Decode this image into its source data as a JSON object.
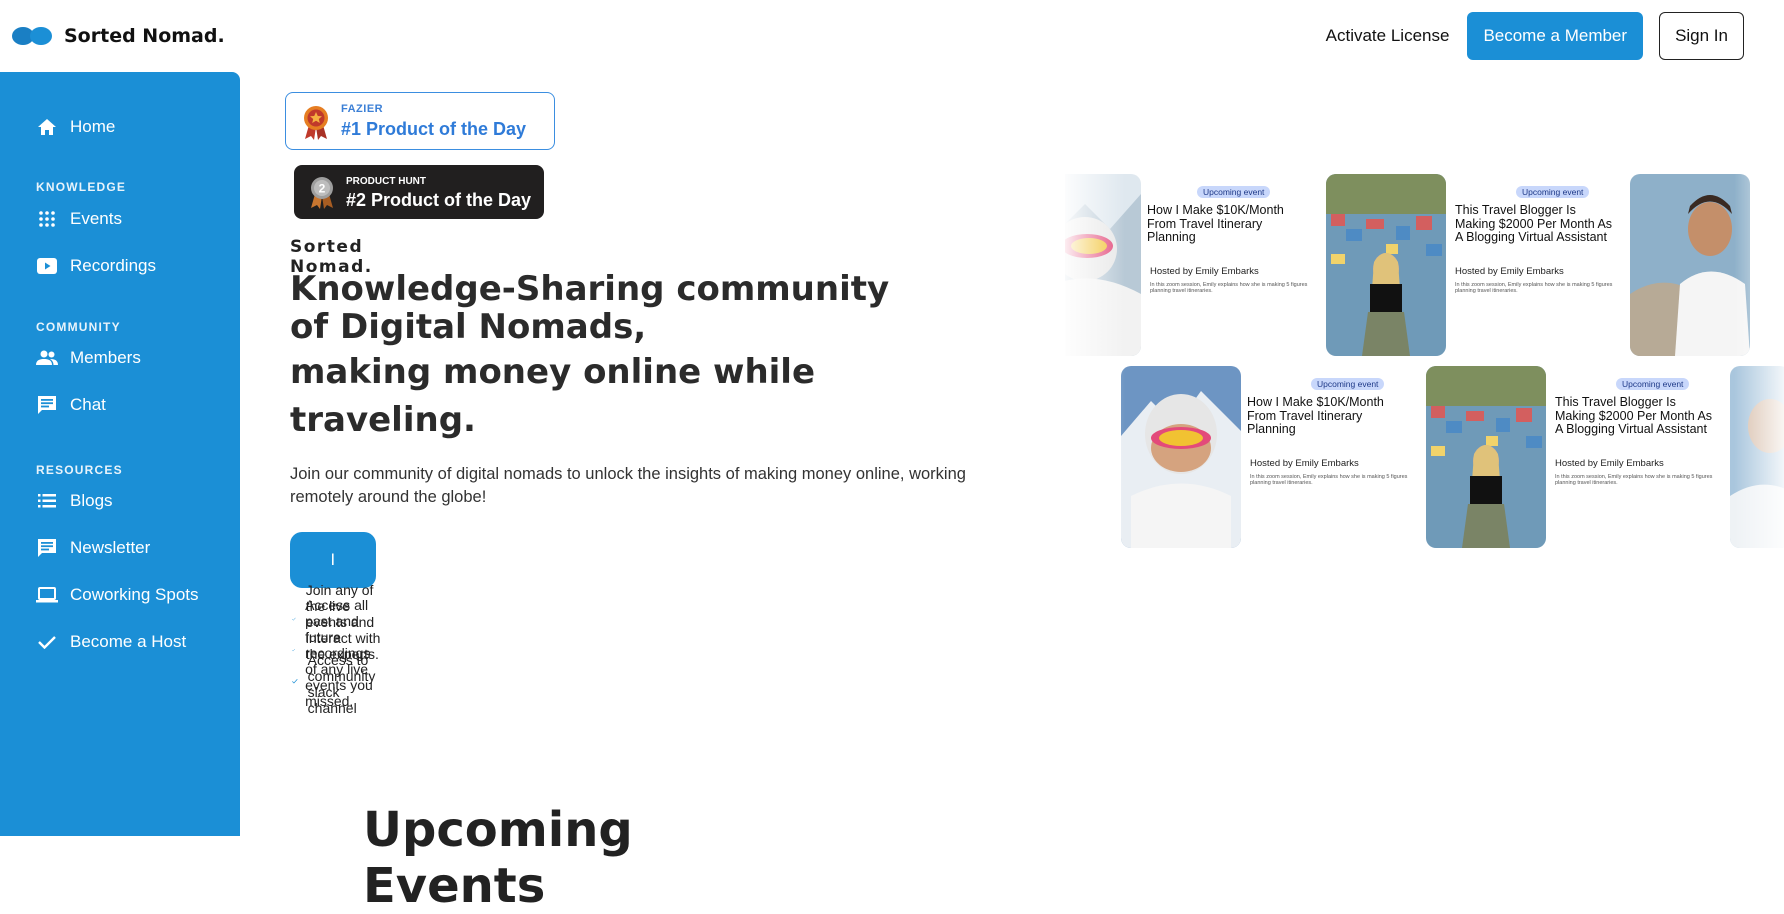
{
  "header": {
    "brand": "Sorted Nomad.",
    "activate_license": "Activate License",
    "become_member": "Become a Member",
    "sign_in": "Sign In"
  },
  "sidebar": {
    "home": "Home",
    "sections": [
      {
        "heading": "KNOWLEDGE",
        "items": [
          "Events",
          "Recordings"
        ]
      },
      {
        "heading": "COMMUNITY",
        "items": [
          "Members",
          "Chat"
        ]
      },
      {
        "heading": "RESOURCES",
        "items": [
          "Blogs",
          "Newsletter",
          "Coworking Spots",
          "Become a Host"
        ]
      }
    ]
  },
  "badges": {
    "fazier_small": "FAZIER",
    "fazier_big": "#1 Product of the Day",
    "ph_small": "PRODUCT HUNT",
    "ph_big": "#2 Product of the Day",
    "ph_rank": "2"
  },
  "hero": {
    "brand_small": "Sorted Nomad.",
    "line1": "Knowledge-Sharing community of Digital Nomads,",
    "line2": "making money online while",
    "line3": "traveling.",
    "subtitle": "Join our community of digital nomads to unlock the insights of making money online, working remotely around the globe!",
    "cta": "I WANT TO JOIN FOR FREE",
    "bullets": [
      "Join any of the live events and interact with the experts.",
      "Access all past and future recordings of any live events you missed.",
      "Access to community slack channel"
    ]
  },
  "cards": {
    "tag": "Upcoming event",
    "card1_title": "How I Make $10K/Month From Travel Itinerary Planning",
    "card2_title": "This Travel Blogger Is Making  $2000 Per Month As A Blogging Virtual Assistant",
    "host_prefix": "Hosted by ",
    "host_name": "Emily Embarks",
    "desc": "In this zoom session, Emily explains how she is making 5 figures planning travel itineraries."
  },
  "sections": {
    "upcoming_title": "Upcoming Events"
  },
  "colors": {
    "primary": "#1b8fd6",
    "fazier_blue": "#2f7bd8",
    "ph_dark": "#211f1f"
  }
}
